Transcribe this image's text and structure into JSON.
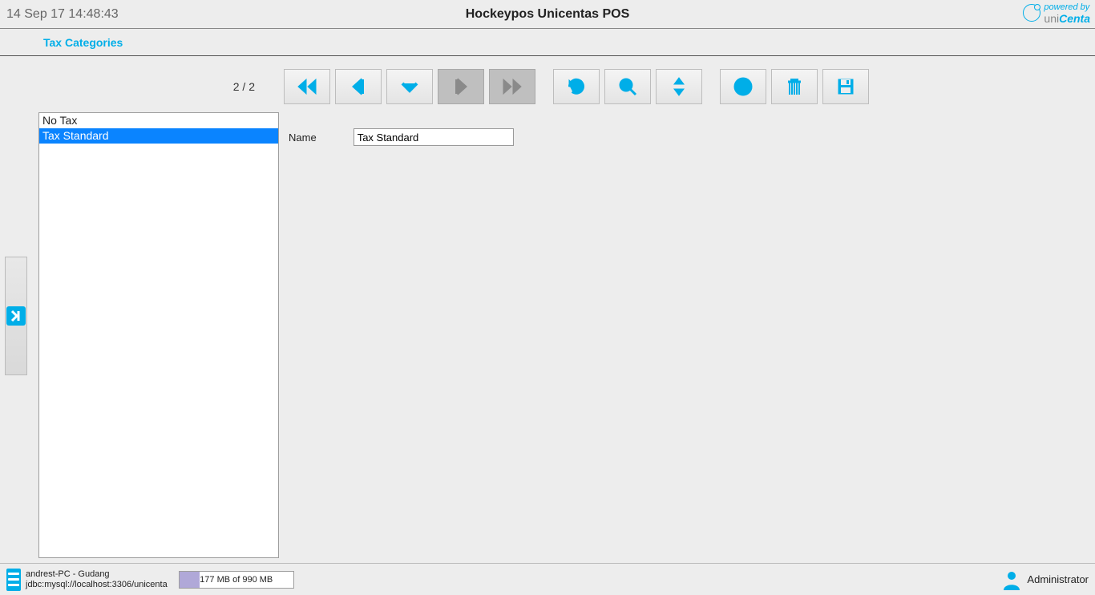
{
  "header": {
    "timestamp": "14 Sep 17 14:48:43",
    "app_title": "Hockeypos Unicentas POS",
    "branding_line1": "powered by",
    "branding_line2a": "uni",
    "branding_line2b": "Centa"
  },
  "panel": {
    "title": "Tax Categories"
  },
  "pager": {
    "label": "2 / 2"
  },
  "list": {
    "items": [
      "No Tax",
      "Tax Standard"
    ],
    "selected_index": 1
  },
  "form": {
    "name_label": "Name",
    "name_value": "Tax Standard"
  },
  "status": {
    "host": "andrest-PC - Gudang",
    "conn": "jdbc:mysql://localhost:3306/unicenta",
    "memory": "177 MB of 990 MB",
    "user": "Administrator"
  }
}
